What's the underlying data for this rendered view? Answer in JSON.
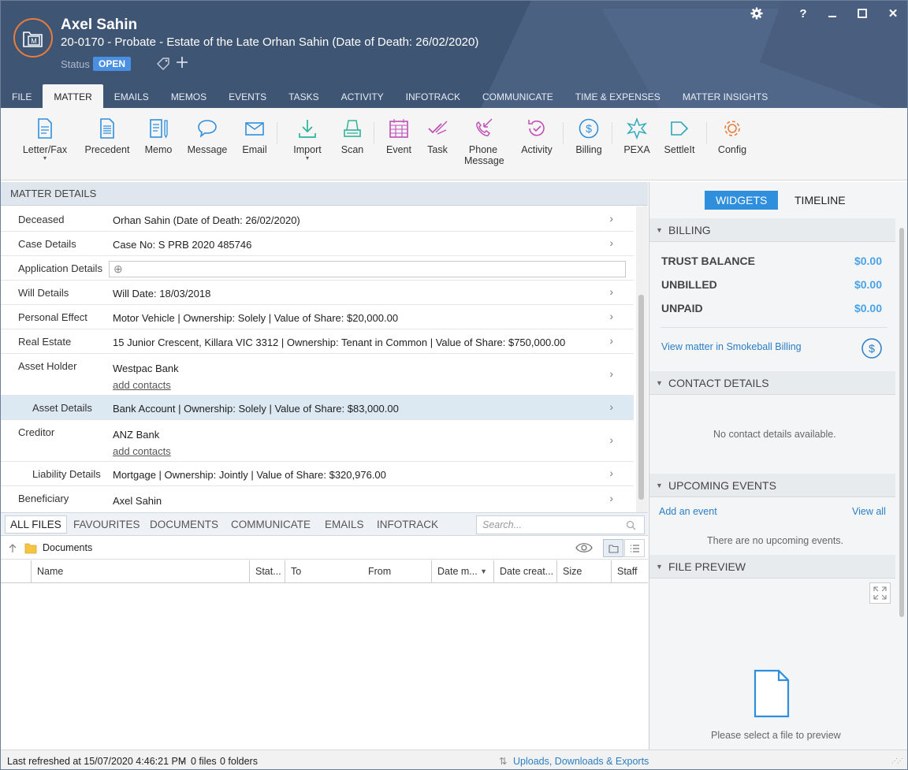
{
  "header": {
    "client_name": "Axel Sahin",
    "matter_line": "20-0170 - Probate - Estate of the Late Orhan Sahin (Date of Death: 26/02/2020)",
    "status_label": "Status",
    "status_value": "OPEN",
    "logo_letter": "M",
    "window_icons": [
      "gear-icon",
      "help-icon",
      "minimize-icon",
      "maximize-icon",
      "close-icon"
    ],
    "help_glyph": "?",
    "close_glyph": "✕"
  },
  "tabs": [
    "FILE",
    "MATTER",
    "EMAILS",
    "MEMOS",
    "EVENTS",
    "TASKS",
    "ACTIVITY",
    "INFOTRACK",
    "COMMUNICATE",
    "TIME & EXPENSES",
    "MATTER INSIGHTS"
  ],
  "active_tab": "MATTER",
  "toolbar": {
    "letter_fax": "Letter/Fax",
    "precedent": "Precedent",
    "memo": "Memo",
    "message": "Message",
    "email": "Email",
    "import": "Import",
    "scan": "Scan",
    "event": "Event",
    "task": "Task",
    "phone_message_1": "Phone",
    "phone_message_2": "Message",
    "activity": "Activity",
    "billing": "Billing",
    "pexa": "PEXA",
    "settleit": "SettleIt",
    "config": "Config",
    "caret": "▾"
  },
  "matter_details": {
    "title": "MATTER DETAILS",
    "rows": [
      {
        "label": "Deceased",
        "value": "Orhan Sahin (Date of Death: 26/02/2020)"
      },
      {
        "label": "Case Details",
        "value": "Case No: S PRB 2020 485746"
      },
      {
        "label": "Application Details",
        "value": ""
      },
      {
        "label": "Will Details",
        "value": "Will Date: 18/03/2018"
      },
      {
        "label": "Personal Effect",
        "value": "Motor Vehicle | Ownership: Solely | Value of Share: $20,000.00"
      },
      {
        "label": "Real Estate",
        "value": "15 Junior Crescent, Killara VIC 3312 | Ownership: Tenant in Common | Value of Share: $750,000.00"
      },
      {
        "label": "Asset Holder",
        "value": "Westpac Bank",
        "sub": "add contacts"
      },
      {
        "label": "Asset Details",
        "value": "Bank Account | Ownership: Solely | Value of Share: $83,000.00"
      },
      {
        "label": "Creditor",
        "value": "ANZ Bank",
        "sub": "add contacts"
      },
      {
        "label": "Liability Details",
        "value": "Mortgage | Ownership: Jointly | Value of Share: $320,976.00"
      },
      {
        "label": "Beneficiary",
        "value": "Axel Sahin"
      }
    ],
    "chevron": "›",
    "add_glyph": "⊕"
  },
  "files": {
    "tabs": [
      "ALL FILES",
      "FAVOURITES",
      "DOCUMENTS",
      "COMMUNICATE",
      "EMAILS",
      "INFOTRACK"
    ],
    "search_placeholder": "Search...",
    "path": "Documents",
    "columns": [
      "Name",
      "Stat...",
      "To",
      "From",
      "Date m...",
      "Date creat...",
      "Size",
      "Staff"
    ],
    "sort_glyph": "▼"
  },
  "status_bar": {
    "refreshed": "Last refreshed at 15/07/2020 4:46:21 PM",
    "sep": "-",
    "files_count": "0 files",
    "folders_count": "0 folders",
    "uploads_link": "Uploads, Downloads & Exports",
    "uploads_glyph": "⇅"
  },
  "right_panel": {
    "widgets_tab": "WIDGETS",
    "timeline_tab": "TIMELINE",
    "billing": {
      "title": "BILLING",
      "rows": [
        {
          "label": "TRUST BALANCE",
          "value": "$0.00"
        },
        {
          "label": "UNBILLED",
          "value": "$0.00"
        },
        {
          "label": "UNPAID",
          "value": "$0.00"
        }
      ],
      "link": "View matter in Smokeball Billing"
    },
    "contact": {
      "title": "CONTACT DETAILS",
      "empty": "No contact details available."
    },
    "events": {
      "title": "UPCOMING EVENTS",
      "add": "Add an event",
      "view_all": "View all",
      "empty": "There are no upcoming events."
    },
    "preview": {
      "title": "FILE PREVIEW",
      "empty": "Please select a file to preview"
    },
    "tri_glyph": "▼"
  },
  "colors": {
    "header_bg": "#3f5574",
    "accent": "#2f8fdc",
    "logo_ring": "#e87c3e",
    "status_badge": "#4a90e2"
  }
}
